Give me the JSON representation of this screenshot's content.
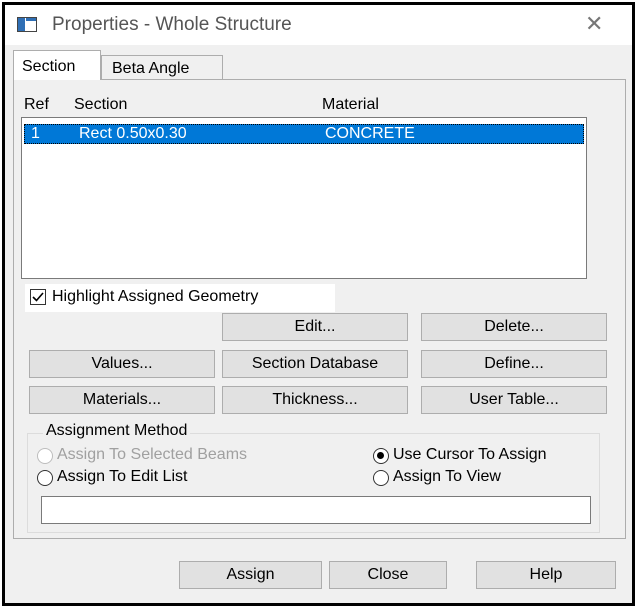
{
  "window": {
    "title": "Properties - Whole Structure",
    "close_glyph": "✕"
  },
  "tabs": [
    {
      "label": "Section",
      "active": true
    },
    {
      "label": "Beta Angle",
      "active": false
    }
  ],
  "table": {
    "columns": [
      "Ref",
      "Section",
      "Material"
    ],
    "rows": [
      {
        "ref": "1",
        "section": "Rect 0.50x0.30",
        "material": "CONCRETE",
        "selected": true
      }
    ]
  },
  "highlight_checkbox": {
    "label": "Highlight Assigned Geometry",
    "checked": true
  },
  "buttons": {
    "edit": "Edit...",
    "delete": "Delete...",
    "values": "Values...",
    "section_database": "Section Database",
    "define": "Define...",
    "materials": "Materials...",
    "thickness": "Thickness...",
    "user_table": "User Table..."
  },
  "assignment": {
    "title": "Assignment Method",
    "options": [
      {
        "label": "Assign To Selected Beams",
        "selected": false,
        "enabled": false
      },
      {
        "label": "Use Cursor To Assign",
        "selected": true,
        "enabled": true
      },
      {
        "label": "Assign To Edit List",
        "selected": false,
        "enabled": true
      },
      {
        "label": "Assign To View",
        "selected": false,
        "enabled": true
      }
    ],
    "input_value": ""
  },
  "footer_buttons": {
    "assign": "Assign",
    "close": "Close",
    "help": "Help"
  },
  "colors": {
    "selection": "#0078d7",
    "dialog_bg": "#f0f0f0",
    "button_bg": "#e1e1e1"
  }
}
